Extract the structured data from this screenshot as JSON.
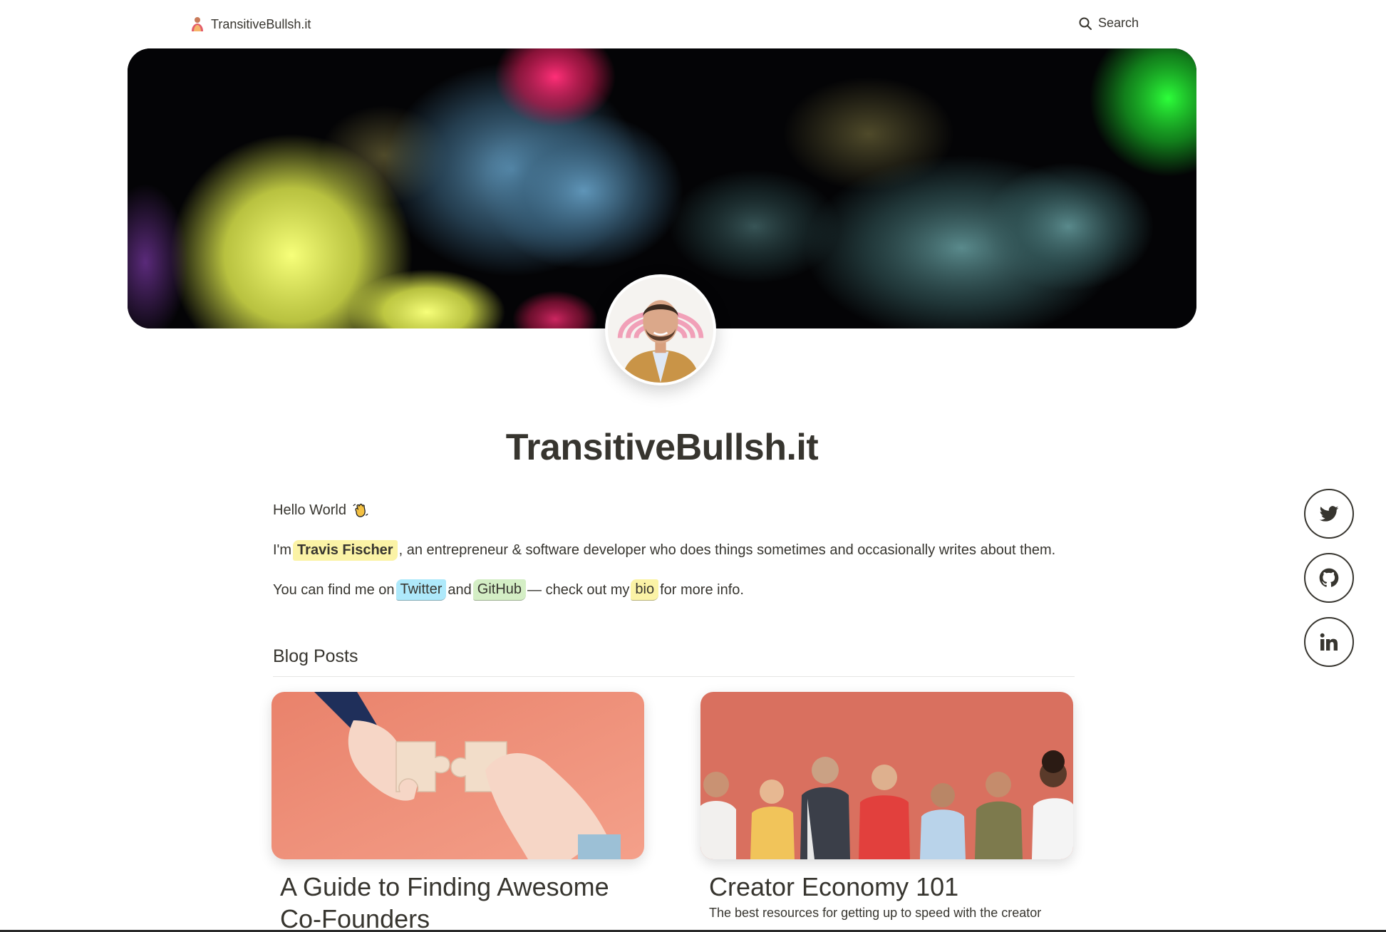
{
  "nav": {
    "brand": "TransitiveBullsh.it",
    "search_label": "Search",
    "brand_icon": "site-logo-icon",
    "search_icon": "search-icon"
  },
  "page": {
    "title": "TransitiveBullsh.it"
  },
  "intro": {
    "hello": "Hello World",
    "hello_emoji": "waving-hand-icon",
    "p2_prefix": "I'm",
    "name": "Travis Fischer",
    "p2_suffix": ", an entrepreneur & software developer who does things sometimes and occasionally writes about them.",
    "p3_prefix": "You can find me on",
    "twitter": "Twitter",
    "p3_and": "and",
    "github": "GitHub",
    "p3_mid": "— check out my",
    "bio": "bio",
    "p3_suffix": "for more info."
  },
  "blog": {
    "section_title": "Blog Posts",
    "posts": [
      {
        "title": "A Guide to Finding Awesome Co-Founders",
        "description": ""
      },
      {
        "title": "Creator Economy 101",
        "description": "The best resources for getting up to speed with the creator"
      }
    ]
  },
  "social": [
    {
      "name": "twitter",
      "icon": "twitter-icon"
    },
    {
      "name": "github",
      "icon": "github-icon"
    },
    {
      "name": "linkedin",
      "icon": "linkedin-icon"
    }
  ],
  "colors": {
    "text": "#37352f",
    "highlight_yellow": "#fbf3a6",
    "highlight_blue": "#aee9fb",
    "highlight_green": "#d4eec5",
    "card_bg_peach": "#f0917a",
    "card_bg_coral": "#d9705f"
  }
}
